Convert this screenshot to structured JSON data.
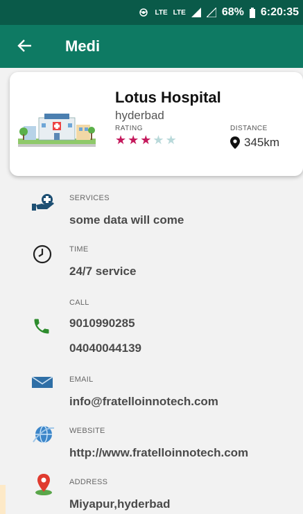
{
  "status_bar": {
    "signal_icon": "hotspot-icon",
    "lte1": "LTE",
    "lte2": "LTE",
    "battery": "68%",
    "time": "6:20:35"
  },
  "app_bar": {
    "title": "Medi",
    "back_icon": "arrow-left-icon"
  },
  "hospital": {
    "name": "Lotus Hospital",
    "city": "hyderbad",
    "rating_label": "RATING",
    "rating": 3,
    "rating_max": 5,
    "distance_label": "DISTANCE",
    "distance": "345km"
  },
  "details": {
    "services": {
      "label": "SERVICES",
      "value": "some data will come"
    },
    "time": {
      "label": "TIME",
      "value": "24/7 service"
    },
    "call": {
      "label": "CALL",
      "phone1": "9010990285",
      "phone2": "04040044139"
    },
    "email": {
      "label": "EMAIL",
      "value": "info@fratelloinnotech.com"
    },
    "website": {
      "label": "WEBSITE",
      "value": "http://www.fratelloinnotech.com"
    },
    "address": {
      "label": "ADDRESS",
      "value": "Miyapur,hyderbad"
    }
  },
  "colors": {
    "status_bar": "#0a5a49",
    "app_bar": "#0e7a63",
    "star_on": "#c4195c",
    "star_off": "#b9d9da"
  }
}
